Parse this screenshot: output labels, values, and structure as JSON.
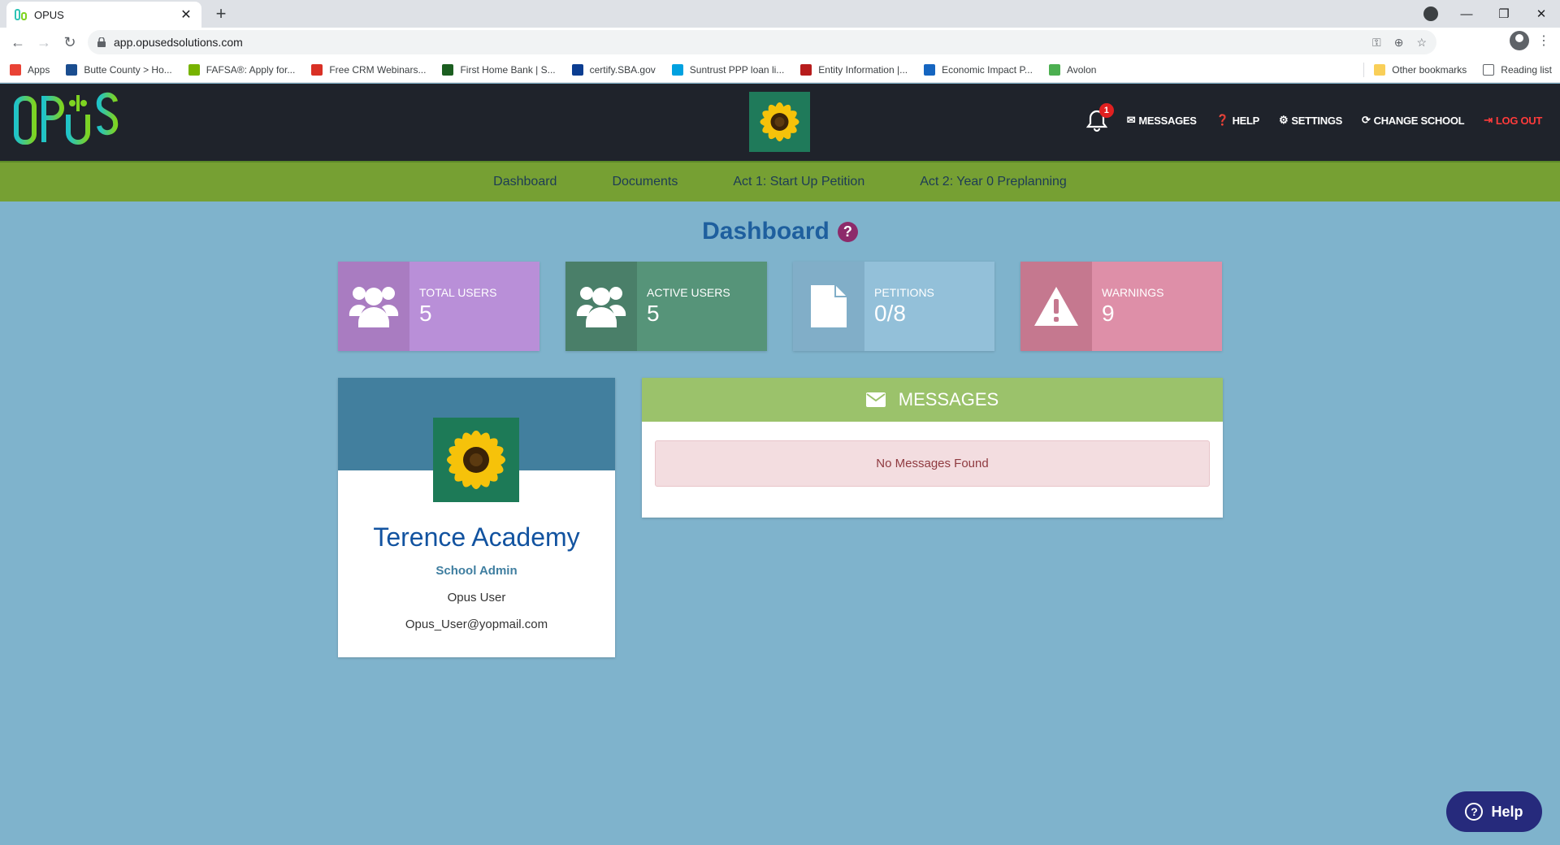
{
  "browser": {
    "tab_title": "OPUS",
    "url": "app.opusedsolutions.com",
    "bookmarks": [
      {
        "label": "Apps",
        "color": "#e94235"
      },
      {
        "label": "Butte County > Ho...",
        "color": "#1a4d8f"
      },
      {
        "label": "FAFSA®: Apply for...",
        "color": "#77b300"
      },
      {
        "label": "Free CRM Webinars...",
        "color": "#d93025"
      },
      {
        "label": "First Home Bank | S...",
        "color": "#1b5e20"
      },
      {
        "label": "certify.SBA.gov",
        "color": "#0b3d91"
      },
      {
        "label": "Suntrust PPP loan li...",
        "color": "#00a1e0"
      },
      {
        "label": "Entity Information |...",
        "color": "#b71c1c"
      },
      {
        "label": "Economic Impact P...",
        "color": "#1565c0"
      },
      {
        "label": "Avolon",
        "color": "#4caf50"
      }
    ],
    "other_bookmarks": "Other bookmarks",
    "reading_list": "Reading list"
  },
  "header": {
    "notification_count": "1",
    "nav": [
      {
        "label": "MESSAGES",
        "icon": "envelope-icon"
      },
      {
        "label": "HELP",
        "icon": "question-circle-icon"
      },
      {
        "label": "SETTINGS",
        "icon": "gear-icon"
      },
      {
        "label": "CHANGE SCHOOL",
        "icon": "refresh-icon"
      },
      {
        "label": "LOG OUT",
        "icon": "sign-out-icon"
      }
    ]
  },
  "subnav": [
    "Dashboard",
    "Documents",
    "Act 1: Start Up Petition",
    "Act 2: Year 0 Preplanning"
  ],
  "page_title": "Dashboard",
  "stats": [
    {
      "label": "TOTAL USERS",
      "value": "5",
      "icon": "users-icon",
      "icon_bg": "#a97cc1",
      "bg": "#b98fd8"
    },
    {
      "label": "ACTIVE USERS",
      "value": "5",
      "icon": "users-icon",
      "icon_bg": "#4a7f69",
      "bg": "#569479"
    },
    {
      "label": "PETITIONS",
      "value": "0/8",
      "icon": "document-icon",
      "icon_bg": "#81aec8",
      "bg": "#93c0d9"
    },
    {
      "label": "WARNINGS",
      "value": "9",
      "icon": "warning-icon",
      "icon_bg": "#c5788f",
      "bg": "#de8fa8"
    }
  ],
  "profile": {
    "school_name": "Terence Academy",
    "role": "School Admin",
    "user_name": "Opus User",
    "email": "Opus_User@yopmail.com"
  },
  "messages": {
    "title": "MESSAGES",
    "empty_text": "No Messages Found"
  },
  "help_fab": "Help"
}
